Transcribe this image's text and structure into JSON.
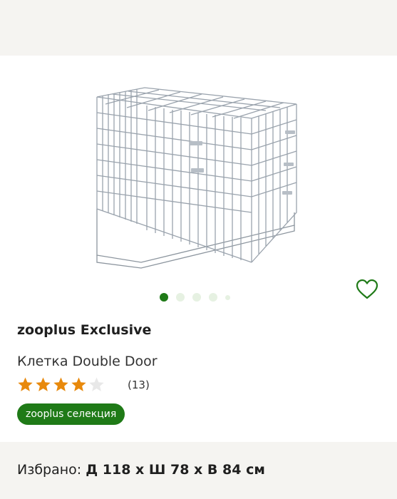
{
  "product": {
    "image_icon": "dog-cage-image",
    "brand": "zooplus Exclusive",
    "title": "Клетка Double Door",
    "rating": {
      "value": 4,
      "max": 5,
      "count": "(13)"
    },
    "badge": "zooplus селекция"
  },
  "carousel": {
    "total": 5,
    "active": 1
  },
  "wishlist_icon": "heart-outline-icon",
  "variant": {
    "label": "Избрано:",
    "value": "Д 118 х Ш 78 х В 84 см"
  },
  "colors": {
    "accent": "#1f7a17",
    "star_filled": "#e8890c",
    "star_empty": "#e8e8e8",
    "band_background": "#f5f4f1"
  }
}
